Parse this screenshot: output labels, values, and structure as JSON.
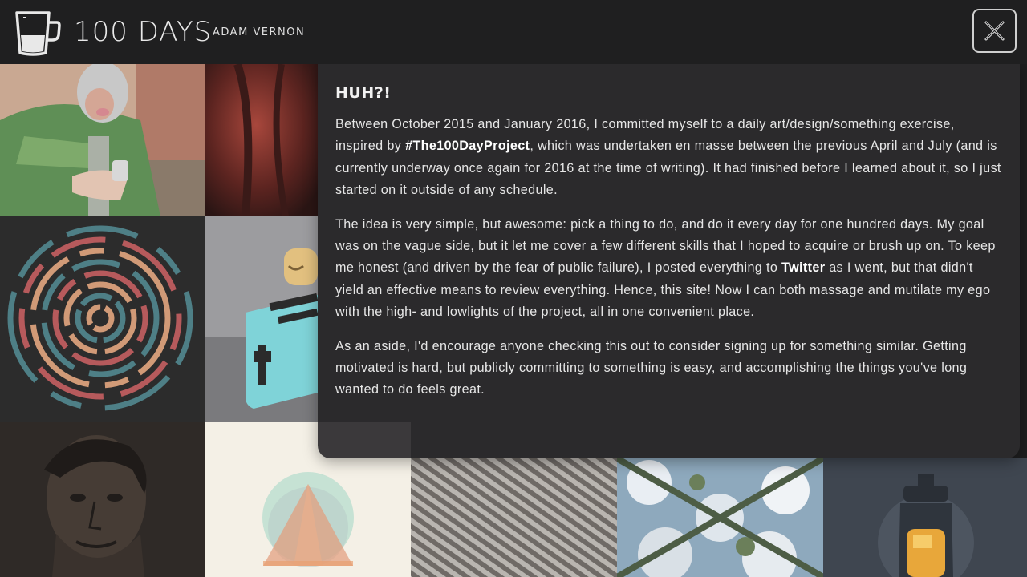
{
  "header": {
    "title": "100 DAYS",
    "author": "ADAM VERNON",
    "logo_icon": "coffee-glass-icon",
    "close_icon": "close-x-icon"
  },
  "modal": {
    "heading": "HUH?!",
    "paragraphs": [
      {
        "before": "Between October 2015 and January 2016, I committed myself to a daily art/design/something exercise, inspired by ",
        "link": "#The100DayProject",
        "after": ", which was undertaken en masse between the previous April and July (and is currently underway once again for 2016 at the time of writing). It had finished before I learned about it, so I just started on it outside of any schedule."
      },
      {
        "before": "The idea is very simple, but awesome: pick a thing to do, and do it every day for one hundred days. My goal was on the vague side, but it let me cover a few different skills that I hoped to acquire or brush up on. To keep me honest (and driven by the fear of public failure), I posted everything to ",
        "link": "Twitter",
        "after": " as I went, but that didn't yield an effective means to review everything. Hence, this site! Now I can both massage and mutilate my ego with the high- and lowlights of the project, all in one convenient place."
      },
      {
        "text": "As an aside, I'd encourage anyone checking this out to consider signing up for something similar. Getting motivated is hard, but publicly committing to something is easy, and accomplishing the things you've long wanted to do feels great."
      }
    ]
  },
  "colors": {
    "header_bg": "#1f1f20",
    "modal_bg": "#2c2b2d",
    "text": "#e6e6e6"
  }
}
